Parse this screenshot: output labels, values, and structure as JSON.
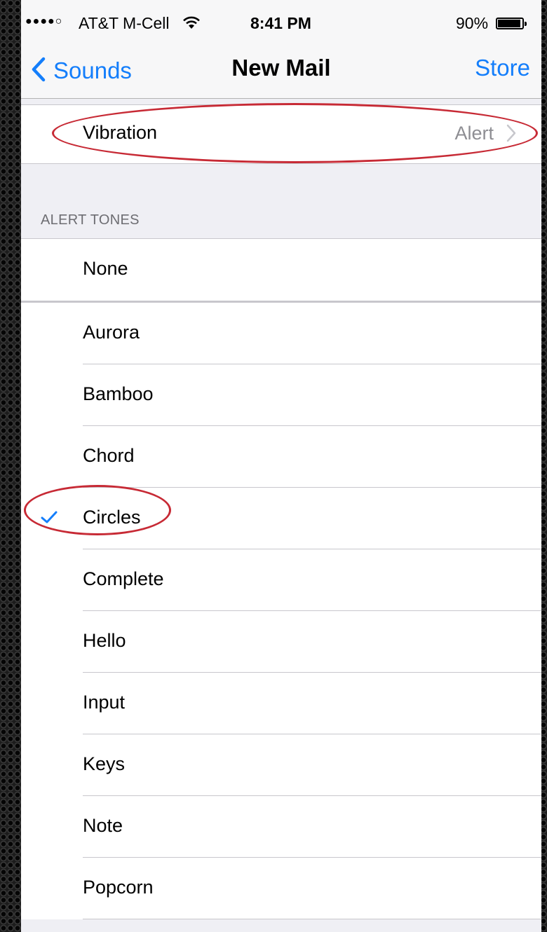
{
  "status_bar": {
    "signal": "●●●●○",
    "carrier": "AT&T M-Cell",
    "time": "8:41 PM",
    "battery_percent": "90%",
    "battery_level": 0.9
  },
  "nav": {
    "back_label": "Sounds",
    "title": "New Mail",
    "right_button": "Store"
  },
  "vibration": {
    "label": "Vibration",
    "value": "Alert"
  },
  "section_header": "ALERT TONES",
  "tones": {
    "none": "None",
    "list": [
      "Aurora",
      "Bamboo",
      "Chord",
      "Circles",
      "Complete",
      "Hello",
      "Input",
      "Keys",
      "Note",
      "Popcorn"
    ]
  },
  "selected_tone": "Circles",
  "colors": {
    "accent": "#147efb",
    "annotation": "#c72a35",
    "background": "#efeff4"
  },
  "icons": {
    "back": "chevron-left-icon",
    "disclosure": "chevron-right-icon",
    "check": "checkmark-icon",
    "wifi": "wifi-icon",
    "battery": "battery-icon"
  }
}
